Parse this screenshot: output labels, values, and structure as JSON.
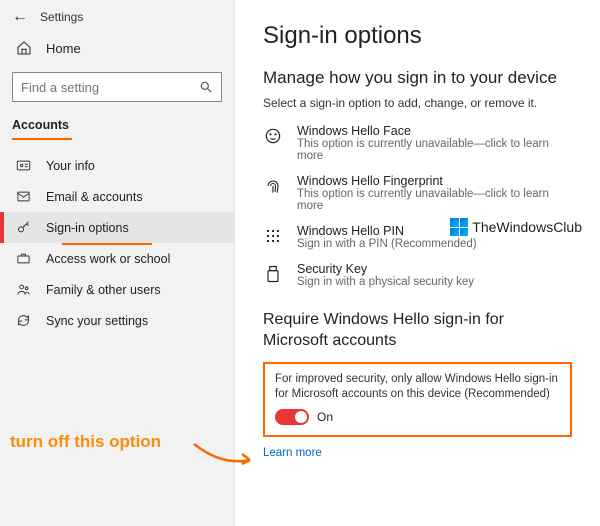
{
  "header": {
    "back": "←",
    "title": "Settings"
  },
  "home": {
    "label": "Home"
  },
  "search": {
    "placeholder": "Find a setting"
  },
  "section_label": "Accounts",
  "nav": {
    "yourinfo": "Your info",
    "email": "Email & accounts",
    "signin": "Sign-in options",
    "workschool": "Access work or school",
    "family": "Family & other users",
    "sync": "Sync your settings"
  },
  "page": {
    "title": "Sign-in options",
    "subtitle": "Manage how you sign in to your device",
    "select_hint": "Select a sign-in option to add, change, or remove it.",
    "options": {
      "face": {
        "title": "Windows Hello Face",
        "desc": "This option is currently unavailable—click to learn more"
      },
      "fingerprint": {
        "title": "Windows Hello Fingerprint",
        "desc": "This option is currently unavailable—click to learn more"
      },
      "pin": {
        "title": "Windows Hello PIN",
        "desc": "Sign in with a PIN (Recommended)"
      },
      "seckey": {
        "title": "Security Key",
        "desc": "Sign in with a physical security key"
      }
    },
    "require_heading": "Require Windows Hello sign-in for Microsoft accounts",
    "require_desc": "For improved security, only allow Windows Hello sign-in for Microsoft accounts on this device (Recommended)",
    "toggle_state": "On",
    "learn_more": "Learn more"
  },
  "watermark": "TheWindowsClub",
  "annotation": "turn off this option"
}
